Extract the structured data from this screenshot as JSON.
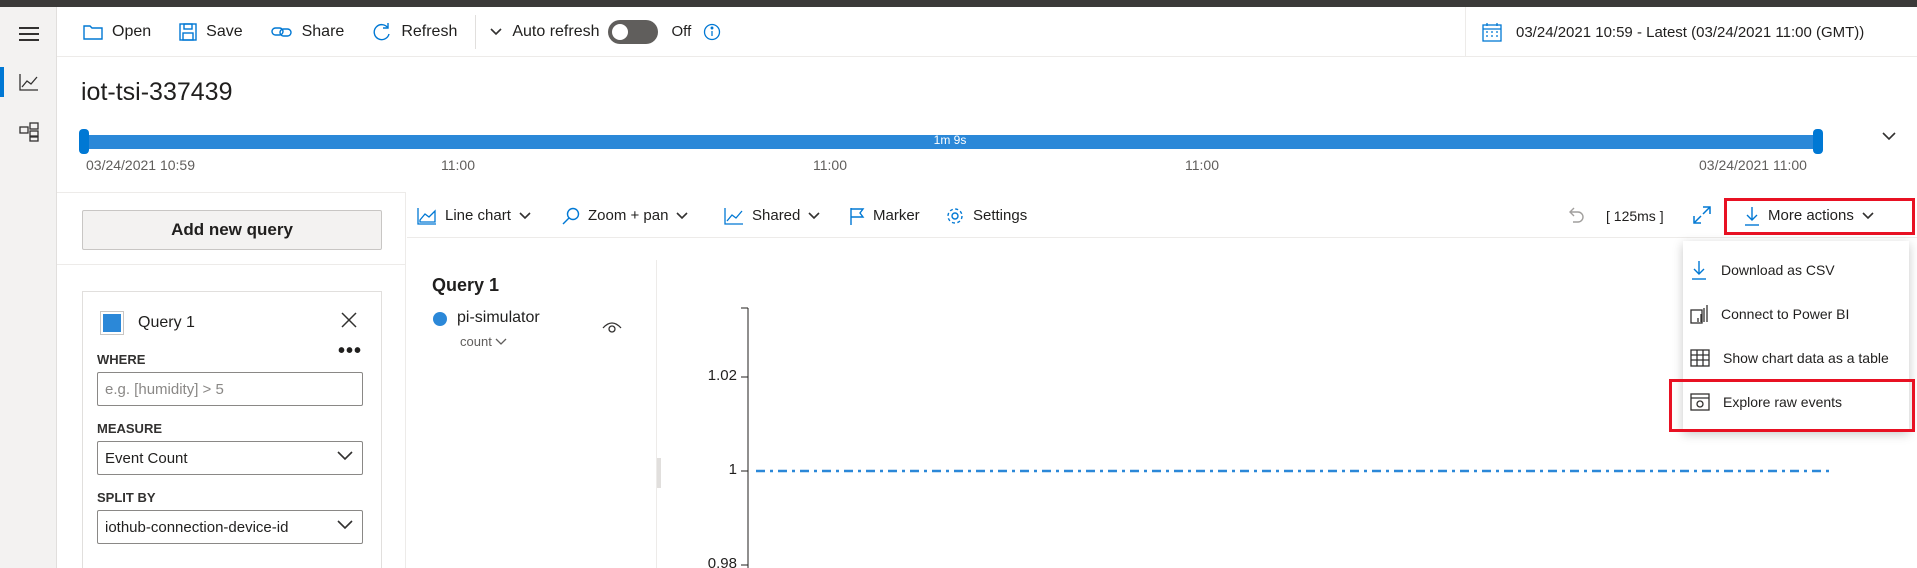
{
  "toolbar": {
    "open_label": "Open",
    "save_label": "Save",
    "share_label": "Share",
    "refresh_label": "Refresh",
    "auto_refresh_label": "Auto refresh",
    "auto_refresh_state": "Off",
    "date_range": "03/24/2021 10:59 - Latest (03/24/2021 11:00 (GMT))"
  },
  "environment": {
    "title": "iot-tsi-337439"
  },
  "timeline": {
    "duration": "1m 9s",
    "labels": [
      "03/24/2021 10:59",
      "11:00",
      "11:00",
      "11:00",
      "03/24/2021 11:00"
    ]
  },
  "query_panel": {
    "add_query_label": "Add new query",
    "query_name": "Query 1",
    "more_glyph": "•••",
    "where_label": "WHERE",
    "where_placeholder": "e.g. [humidity] > 5",
    "measure_label": "MEASURE",
    "measure_value": "Event Count",
    "split_by_label": "SPLIT BY",
    "split_by_value": "iothub-connection-device-id"
  },
  "chart_toolbar": {
    "line_chart_label": "Line chart",
    "zoom_label": "Zoom + pan",
    "shared_label": "Shared",
    "marker_label": "Marker",
    "settings_label": "Settings",
    "latency": "[ 125ms ]",
    "more_actions_label": "More actions"
  },
  "more_actions_menu": {
    "items": [
      {
        "label": "Download as CSV",
        "icon": "download-icon"
      },
      {
        "label": "Connect to Power BI",
        "icon": "power-bi-icon"
      },
      {
        "label": "Show chart data as a table",
        "icon": "table-icon"
      },
      {
        "label": "Explore raw events",
        "icon": "raw-events-icon"
      }
    ]
  },
  "legend": {
    "title": "Query 1",
    "series_name": "pi-simulator",
    "series_measure": "count"
  },
  "chart_data": {
    "type": "line",
    "series": [
      {
        "name": "pi-simulator",
        "values": [
          1,
          1
        ]
      }
    ],
    "y_ticks": [
      "1.02",
      "1",
      "0.98"
    ],
    "colors": {
      "series": "#2b88d8"
    }
  },
  "colors": {
    "accent": "#0078d4",
    "highlight": "#e81123"
  }
}
